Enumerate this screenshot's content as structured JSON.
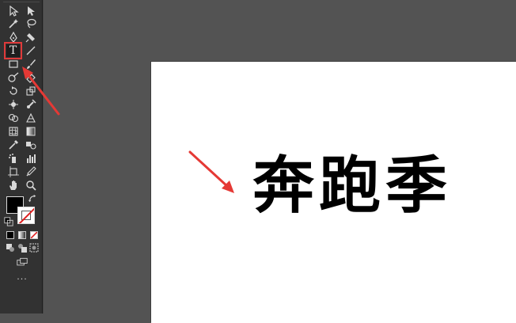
{
  "canvas": {
    "background": "#535353",
    "artboard_color": "#ffffff",
    "artboard_text": "奔跑季"
  },
  "toolbar": {
    "type_tool_label": "T",
    "more_label": "..."
  },
  "annotations": {
    "arrow_color": "#e53935"
  }
}
